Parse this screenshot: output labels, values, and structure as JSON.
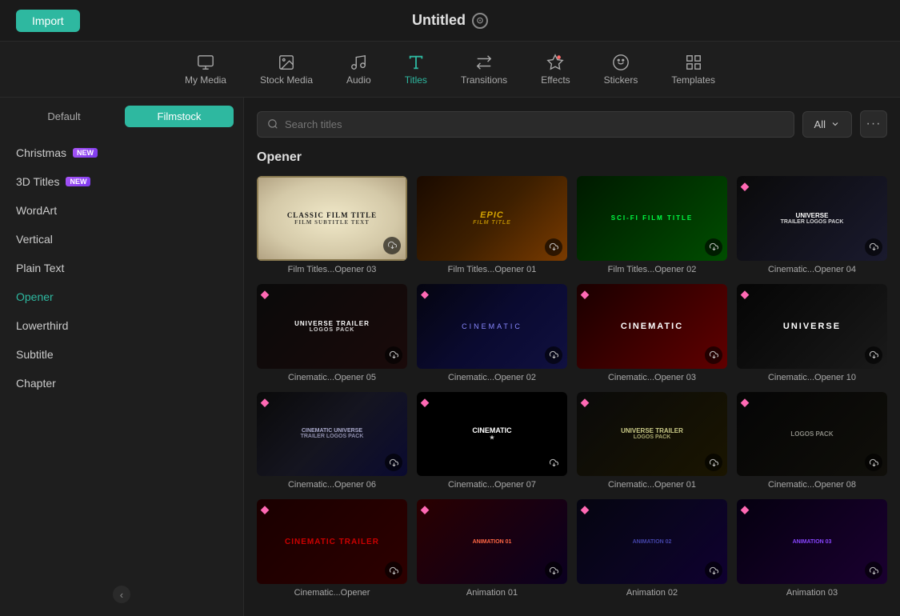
{
  "topbar": {
    "import_label": "Import",
    "project_title": "Untitled"
  },
  "nav": {
    "items": [
      {
        "id": "my-media",
        "label": "My Media",
        "icon": "monitor"
      },
      {
        "id": "stock-media",
        "label": "Stock Media",
        "icon": "folder"
      },
      {
        "id": "audio",
        "label": "Audio",
        "icon": "music"
      },
      {
        "id": "titles",
        "label": "Titles",
        "icon": "text",
        "active": true
      },
      {
        "id": "transitions",
        "label": "Transitions",
        "icon": "arrows"
      },
      {
        "id": "effects",
        "label": "Effects",
        "icon": "star"
      },
      {
        "id": "stickers",
        "label": "Stickers",
        "icon": "sticker"
      },
      {
        "id": "templates",
        "label": "Templates",
        "icon": "grid"
      }
    ]
  },
  "sidebar": {
    "tab_default": "Default",
    "tab_filmstock": "Filmstock",
    "active_tab": "Filmstock",
    "items": [
      {
        "id": "christmas",
        "label": "Christmas",
        "badge": "NEW",
        "active": false
      },
      {
        "id": "3d-titles",
        "label": "3D Titles",
        "badge": "NEW",
        "active": false
      },
      {
        "id": "wordart",
        "label": "WordArt",
        "badge": null,
        "active": false
      },
      {
        "id": "vertical",
        "label": "Vertical",
        "badge": null,
        "active": false
      },
      {
        "id": "plain-text",
        "label": "Plain Text",
        "badge": null,
        "active": false
      },
      {
        "id": "opener",
        "label": "Opener",
        "badge": null,
        "active": true
      },
      {
        "id": "lowerthird",
        "label": "Lowerthird",
        "badge": null,
        "active": false
      },
      {
        "id": "subtitle",
        "label": "Subtitle",
        "badge": null,
        "active": false
      },
      {
        "id": "chapter",
        "label": "Chapter",
        "badge": null,
        "active": false
      }
    ]
  },
  "search": {
    "placeholder": "Search titles",
    "filter_label": "All",
    "more_icon": "•••"
  },
  "main": {
    "section_title": "Opener",
    "cards": [
      {
        "id": "opener-03",
        "label": "Film Titles...Opener 03",
        "thumb_type": "classic-film",
        "premium": false,
        "download": true,
        "text1": "CLASSIC FILM TITLE",
        "text2": "FILM SUBTITLE TEXT"
      },
      {
        "id": "opener-01",
        "label": "Film Titles...Opener 01",
        "thumb_type": "epic-film",
        "premium": false,
        "download": true,
        "text1": "EPIC",
        "text2": "FILM TITLE"
      },
      {
        "id": "opener-02",
        "label": "Film Titles...Opener 02",
        "thumb_type": "scifi",
        "premium": false,
        "download": true,
        "text1": "SCI-FI FILM TITLE"
      },
      {
        "id": "cinematic-opener-04",
        "label": "Cinematic...Opener 04",
        "thumb_type": "universe-trailer-logos",
        "premium": true,
        "download": true,
        "text1": "UNIVERSE",
        "text2": "TRAILER LOGOS PACK"
      },
      {
        "id": "cinematic-opener-05",
        "label": "Cinematic...Opener 05",
        "thumb_type": "universe-trailer",
        "premium": true,
        "download": true,
        "text1": "UNIVERSE TRAILER",
        "text2": "LOGOS PACK"
      },
      {
        "id": "cinematic-opener-02",
        "label": "Cinematic...Opener 02",
        "thumb_type": "cinematic-blue",
        "premium": true,
        "download": true,
        "text1": "CINEMATIC"
      },
      {
        "id": "cinematic-opener-03",
        "label": "Cinematic...Opener 03",
        "thumb_type": "cinematic-red",
        "premium": true,
        "download": true,
        "text1": "CINEMATIC"
      },
      {
        "id": "cinematic-opener-10",
        "label": "Cinematic...Opener 10",
        "thumb_type": "universe-dark",
        "premium": true,
        "download": true,
        "text1": "UNIVERSE"
      },
      {
        "id": "cinematic-opener-06",
        "label": "Cinematic...Opener 06",
        "thumb_type": "cinematic-universe",
        "premium": true,
        "download": true,
        "text1": "CINEMATIC UNIVERSE",
        "text2": "TRAILER LOGOS PACK"
      },
      {
        "id": "cinematic-opener-07",
        "label": "Cinematic...Opener 07",
        "thumb_type": "cinematic-star",
        "premium": true,
        "download": true,
        "text1": "CINEMATIC",
        "text2": "★"
      },
      {
        "id": "cinematic-opener-01",
        "label": "Cinematic...Opener 01",
        "thumb_type": "universe-trailer2",
        "premium": true,
        "download": true,
        "text1": "UNIVERSE TRAILER",
        "text2": "LOGOS PACK"
      },
      {
        "id": "cinematic-opener-08",
        "label": "Cinematic...Opener 08",
        "thumb_type": "logos-pack",
        "premium": true,
        "download": true,
        "text1": "LOGOS PACK"
      },
      {
        "id": "cinematic-opener-row3-1",
        "label": "Cinematic...Opener",
        "thumb_type": "cinematic-red2",
        "premium": true,
        "download": true,
        "text1": "CINEMATIC TRAILER"
      },
      {
        "id": "animation-01",
        "label": "Animation 01",
        "thumb_type": "animation-red",
        "premium": true,
        "download": true,
        "text1": "ANIMATION 01"
      },
      {
        "id": "animation-02",
        "label": "Animation 02",
        "thumb_type": "animation-dark",
        "premium": true,
        "download": true,
        "text1": "ANIMATION 02"
      },
      {
        "id": "animation-03",
        "label": "Animation 03",
        "thumb_type": "animation-purple",
        "premium": true,
        "download": true,
        "text1": "ANIMATION 03"
      }
    ]
  }
}
